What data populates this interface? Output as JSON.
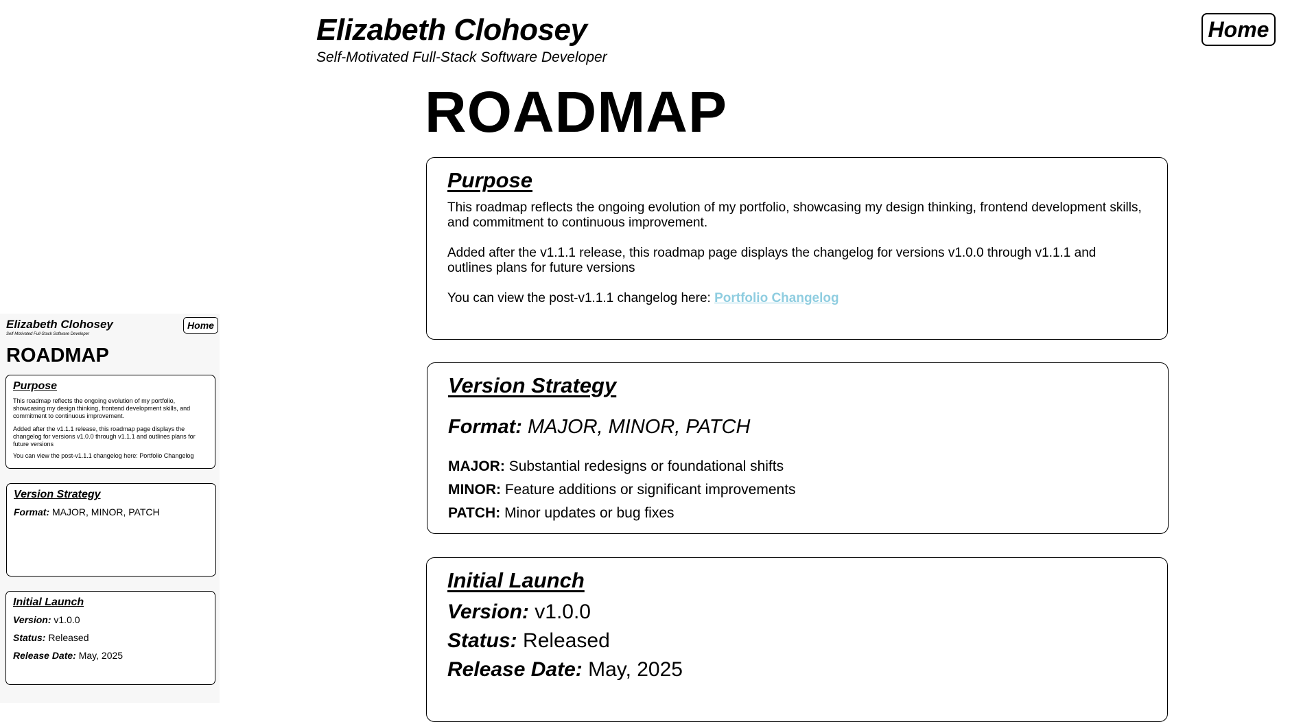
{
  "header": {
    "name": "Elizabeth Clohosey",
    "tagline": "Self-Motivated Full-Stack Software Developer",
    "home_label": "Home"
  },
  "page_title": "ROADMAP",
  "purpose": {
    "heading": "Purpose",
    "p1": "This roadmap reflects the ongoing evolution of my portfolio, showcasing my design thinking, frontend development skills, and commitment to continuous improvement.",
    "p2": "Added after the v1.1.1 release, this roadmap page displays the changelog for versions v1.0.0 through v1.1.1 and outlines plans for future versions",
    "p3_prefix": "You can view the post-v1.1.1 changelog here: ",
    "link_label": "Portfolio Changelog"
  },
  "version_strategy": {
    "heading": "Version Strategy",
    "format_label": "Format:",
    "format_value": "MAJOR, MINOR, PATCH",
    "rules": [
      {
        "key": "MAJOR:",
        "desc": "Substantial redesigns or foundational shifts"
      },
      {
        "key": "MINOR:",
        "desc": "Feature additions or significant improvements"
      },
      {
        "key": "PATCH:",
        "desc": "Minor updates or bug fixes"
      }
    ]
  },
  "initial_launch": {
    "heading": "Initial Launch",
    "version_label": "Version:",
    "version": "v1.0.0",
    "status_label": "Status:",
    "status": "Released",
    "release_label": "Release Date:",
    "release_date": "May, 2025"
  },
  "mobile": {
    "purpose_p3": "You can view the post-v1.1.1 changelog here: Portfolio Changelog"
  },
  "colors": {
    "link": "#8fcde0",
    "border": "#000000",
    "background": "#ffffff"
  }
}
